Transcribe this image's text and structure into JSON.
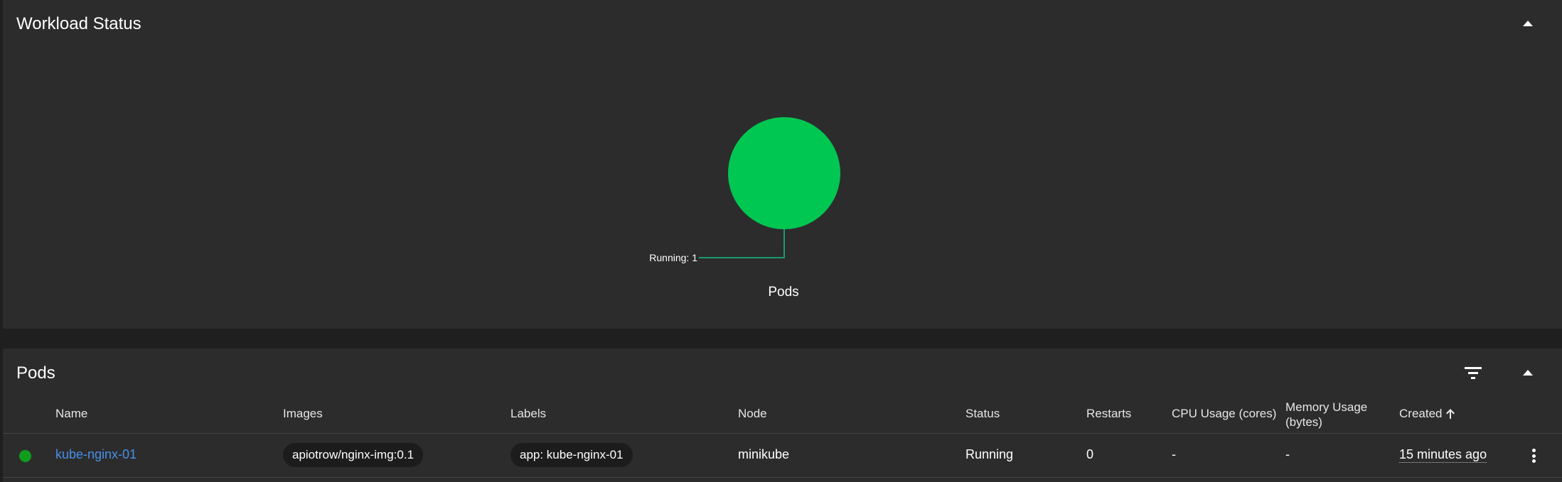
{
  "workload": {
    "title": "Workload Status",
    "chart_caption": "Pods",
    "running_label": "Running: 1"
  },
  "chart_data": {
    "type": "pie",
    "title": "Pods",
    "slices": [
      {
        "label": "Running",
        "value": 1,
        "color": "#00c752"
      }
    ]
  },
  "pods": {
    "title": "Pods",
    "columns": {
      "name": "Name",
      "images": "Images",
      "labels": "Labels",
      "node": "Node",
      "status": "Status",
      "restarts": "Restarts",
      "cpu": "CPU Usage (cores)",
      "memory_line1": "Memory Usage",
      "memory_line2": "(bytes)",
      "created": "Created"
    },
    "rows": [
      {
        "name": "kube-nginx-01",
        "image": "apiotrow/nginx-img:0.1",
        "label": "app: kube-nginx-01",
        "node": "minikube",
        "status": "Running",
        "restarts": "0",
        "cpu": "-",
        "memory": "-",
        "created": "15 minutes ago",
        "status_color": "#119c1e"
      }
    ]
  },
  "icons": {
    "collapse": "chevron-up-icon",
    "filter": "filter-icon",
    "sort": "arrow-up-icon",
    "menu": "more-vert-icon"
  }
}
